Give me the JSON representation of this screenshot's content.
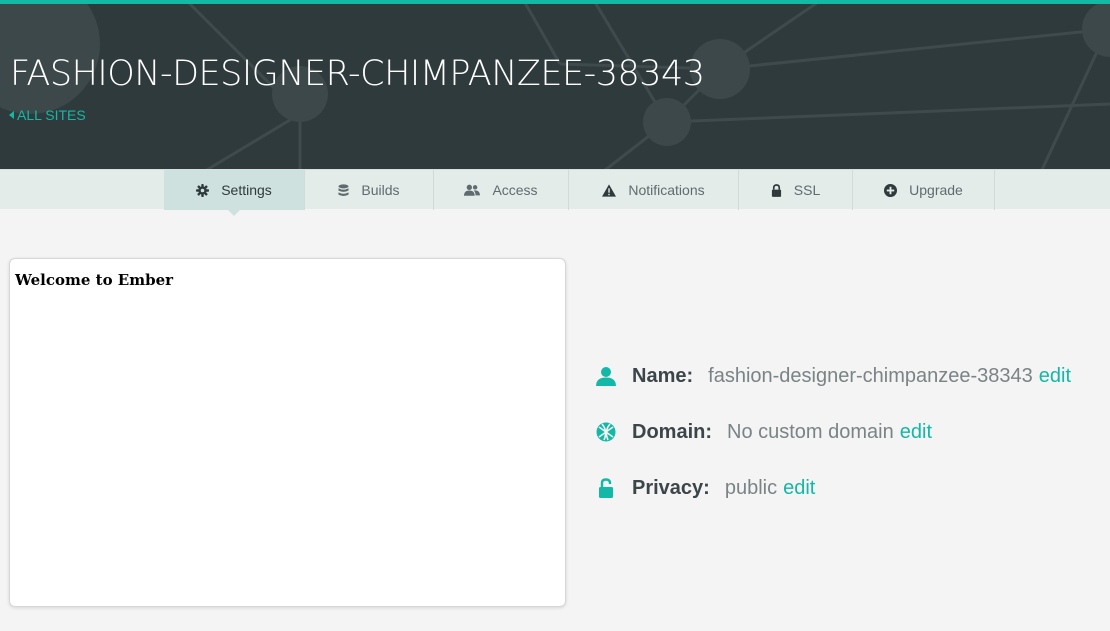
{
  "header": {
    "site_name": "FASHION-DESIGNER-CHIMPANZEE-38343",
    "back_link": "ALL SITES",
    "back_icon": "caret-left-icon"
  },
  "tabs": [
    {
      "label": "Settings",
      "icon": "gear-icon",
      "active": true
    },
    {
      "label": "Builds",
      "icon": "database-icon",
      "active": false
    },
    {
      "label": "Access",
      "icon": "users-icon",
      "active": false
    },
    {
      "label": "Notifications",
      "icon": "warning-icon",
      "active": false
    },
    {
      "label": "SSL",
      "icon": "lock-icon",
      "active": false
    },
    {
      "label": "Upgrade",
      "icon": "plus-circle-icon",
      "active": false
    }
  ],
  "preview": {
    "text": "Welcome to Ember"
  },
  "details": {
    "name": {
      "label": "Name:",
      "value": "fashion-designer-chimpanzee-38343",
      "edit": "edit",
      "icon": "user-icon"
    },
    "domain": {
      "label": "Domain:",
      "value": "No custom domain",
      "edit": "edit",
      "icon": "globe-icon"
    },
    "privacy": {
      "label": "Privacy:",
      "value": "public",
      "edit": "edit",
      "icon": "unlock-icon"
    }
  },
  "colors": {
    "accent": "#14b8a6",
    "header_bg": "#2f3a3d",
    "tabbar_bg": "#e4ecea",
    "active_tab_bg": "#cfe1de",
    "page_bg": "#f3f4f3"
  }
}
